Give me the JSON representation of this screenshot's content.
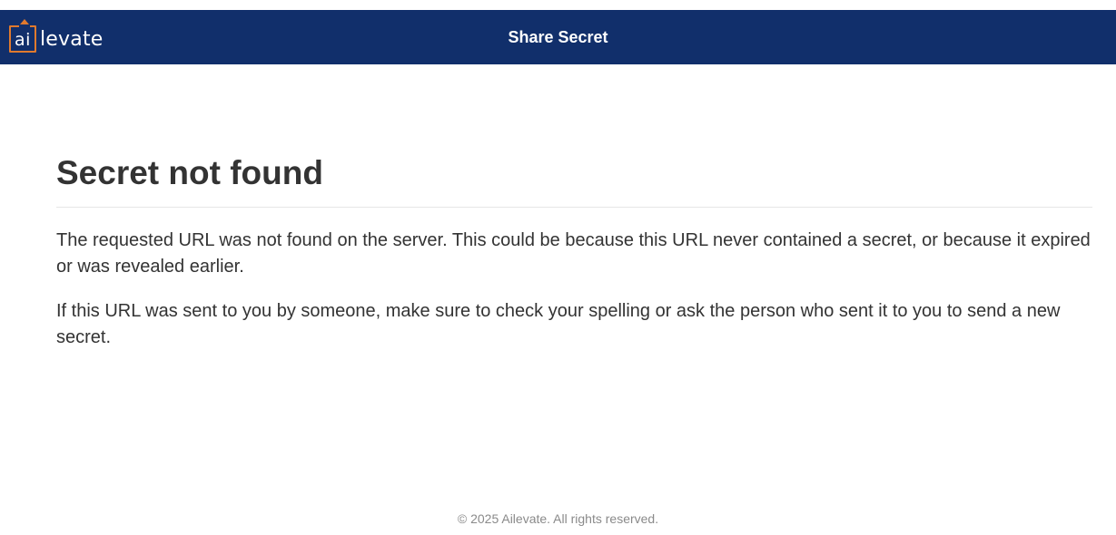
{
  "header": {
    "logo": {
      "mark_text": "ai",
      "word_text": "levate",
      "accent_color": "#e07a2e"
    },
    "title": "Share Secret",
    "background_color": "#112f6b"
  },
  "main": {
    "heading": "Secret not found",
    "paragraphs": [
      "The requested URL was not found on the server. This could be because this URL never contained a secret, or because it expired or was revealed earlier.",
      "If this URL was sent to you by someone, make sure to check your spelling or ask the person who sent it to you to send a new secret."
    ]
  },
  "footer": {
    "copyright": "© 2025 Ailevate. All rights reserved."
  }
}
